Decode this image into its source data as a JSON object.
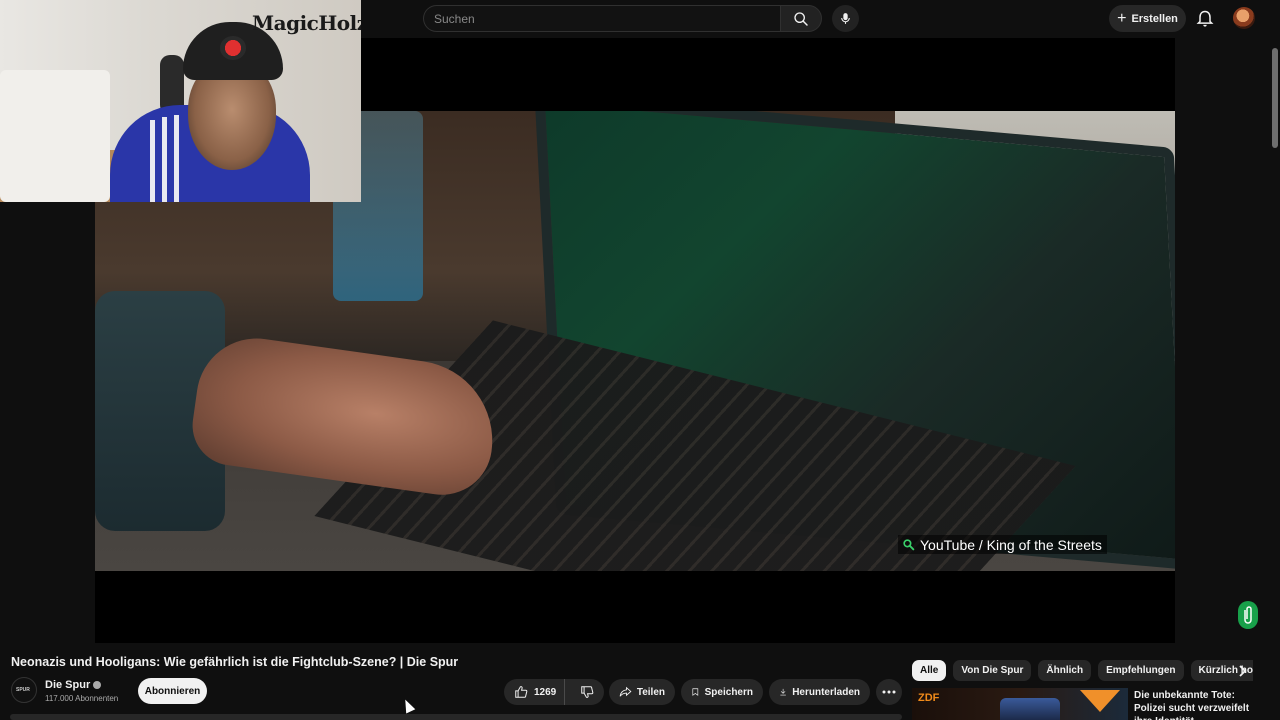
{
  "overlay": {
    "brand": "MagicHolz"
  },
  "search": {
    "placeholder": "Suchen"
  },
  "header": {
    "create_label": "Erstellen",
    "create_icon": "plus-icon",
    "notifications_icon": "bell-icon"
  },
  "player": {
    "caption": "YouTube / King of the Streets"
  },
  "video": {
    "title": "Neonazis und Hooligans: Wie gefährlich ist die Fightclub-Szene? | Die Spur",
    "channel": "Die Spur",
    "channel_avatar_text": "SPUR",
    "subscribers": "117.000 Abonnenten",
    "subscribe_label": "Abonnieren",
    "likes": "1269"
  },
  "actions": {
    "share": "Teilen",
    "save": "Speichern",
    "download": "Herunterladen"
  },
  "chips": [
    "Alle",
    "Von Die Spur",
    "Ähnlich",
    "Empfehlungen",
    "Kürzlich hoch"
  ],
  "recommendation": {
    "title": "Die unbekannte Tote: Polizei sucht verzweifelt ihre Identität",
    "thumb_logo": "ZDF"
  },
  "colors": {
    "background": "#0f0f0f",
    "chip_bg": "#272727",
    "accent_green": "#18a04a"
  }
}
